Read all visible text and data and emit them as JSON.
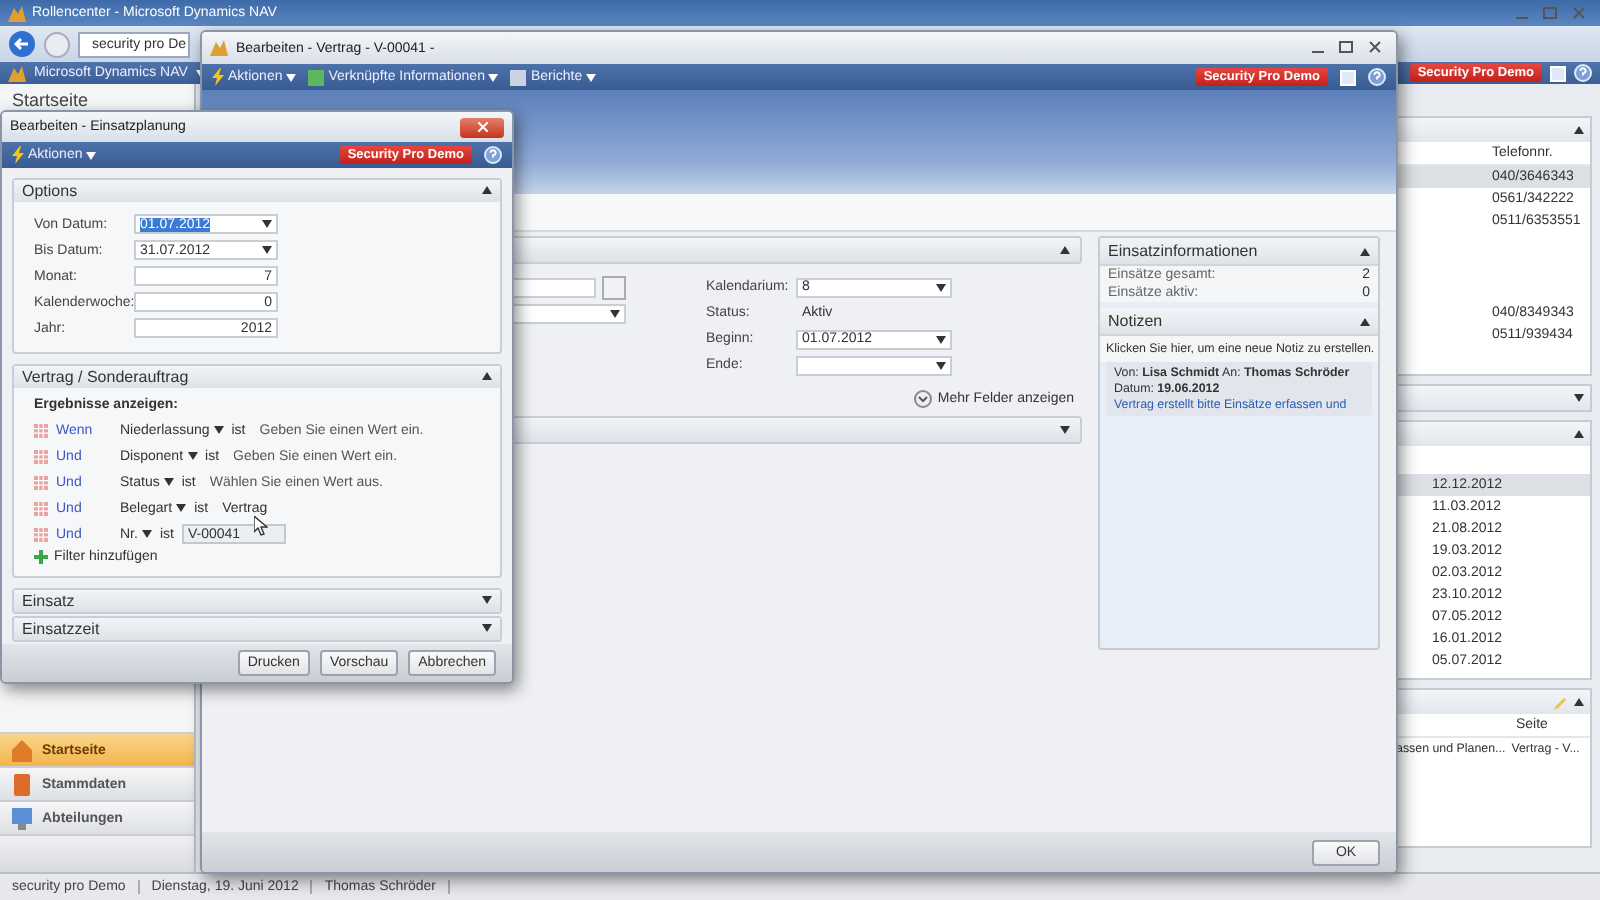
{
  "app": {
    "title": "Rollencenter - Microsoft Dynamics NAV",
    "address": "security pro De",
    "nav_menu": "Microsoft Dynamics NAV",
    "badge": "Security Pro Demo",
    "page_title": "Startseite",
    "navigation": [
      {
        "label": "Startseite",
        "selected": true
      },
      {
        "label": "Stammdaten",
        "selected": false
      },
      {
        "label": "Abteilungen",
        "selected": false
      }
    ],
    "phone_list": {
      "column": "Telefonnr.",
      "rows_top": [
        {
          "text": "040/3646343",
          "selected": true
        },
        {
          "text": "0561/342222",
          "selected": false
        },
        {
          "text": "0511/6353551",
          "selected": false
        }
      ],
      "rows_bottom": [
        {
          "text": "040/8349343",
          "selected": false
        },
        {
          "text": "0511/939434",
          "selected": false
        }
      ]
    },
    "dates": [
      {
        "text": "12.12.2012",
        "selected": true
      },
      {
        "text": "11.03.2012",
        "selected": false
      },
      {
        "text": "21.08.2012",
        "selected": false
      },
      {
        "text": "19.03.2012",
        "selected": false
      },
      {
        "text": "02.03.2012",
        "selected": false
      },
      {
        "text": "23.10.2012",
        "selected": false
      },
      {
        "text": "07.05.2012",
        "selected": false
      },
      {
        "text": "16.01.2012",
        "selected": false
      },
      {
        "text": "05.07.2012",
        "selected": false
      }
    ],
    "pages_list": {
      "column": "Seite",
      "rows": [
        {
          "column_1": "assen und Planen...",
          "seite": "Vertrag - V..."
        }
      ]
    },
    "status_bar": [
      "security pro Demo",
      "Dienstag, 19. Juni 2012",
      "Thomas Schröder"
    ]
  },
  "contract_window": {
    "title": "Bearbeiten - Vertrag - V-00041 -",
    "menu": [
      "Aktionen",
      "Verknüpfte Informationen",
      "Berichte"
    ],
    "badge": "Security Pro Demo",
    "fields": [
      {
        "label": "Kalendarium:",
        "value": "8",
        "dropdown": true
      },
      {
        "label": "Status:",
        "value": "Aktiv",
        "dropdown": false
      },
      {
        "label": "Beginn:",
        "value": "01.07.2012",
        "dropdown": true
      },
      {
        "label": "Ende:",
        "dropdown": true
      }
    ],
    "more_fields": "Mehr Felder anzeigen",
    "factbox": {
      "title": "Einsatzinformationen",
      "rows": [
        {
          "label": "Einsätze gesamt:",
          "value": "2"
        },
        {
          "label": "Einsätze aktiv:",
          "value": "0"
        }
      ]
    },
    "notes": {
      "title": "Notizen",
      "hint": "Klicken Sie hier, um eine neue Notiz zu erstellen.",
      "note_header": "Von: **Lisa Schmidt** An: **Thomas Schröder**",
      "note_date": "Datum: **19.06.2012**",
      "note_text": "Vertrag erstellt bitte Einsätze erfassen und"
    },
    "ok_button": "OK"
  },
  "dialog": {
    "title": "Bearbeiten - Einsatzplanung",
    "menu": "Aktionen",
    "badge": "Security Pro Demo",
    "sections": [
      {
        "title": "Options",
        "expanded": true,
        "kind": "options",
        "fields": [
          {
            "label": "Von Datum:",
            "value": "01.07.2012",
            "dropdown": true,
            "selected": true
          },
          {
            "label": "Bis Datum:",
            "value": "31.07.2012",
            "dropdown": true,
            "selected": false
          },
          {
            "label": "Monat:",
            "value": "7",
            "dropdown": false,
            "selected": false
          },
          {
            "label": "Kalenderwoche:",
            "value": "0",
            "dropdown": false,
            "selected": false
          },
          {
            "label": "Jahr:",
            "value": "2012",
            "dropdown": false,
            "selected": false
          }
        ]
      },
      {
        "title": "Vertrag / Sonderauftrag",
        "expanded": true,
        "kind": "filters",
        "heading": "Ergebnisse anzeigen:",
        "filters": [
          {
            "conjunction": "Wenn",
            "field": "Niederlassung",
            "operator": "ist",
            "placeholder": "Geben Sie einen Wert ein.",
            "kind": "text"
          },
          {
            "conjunction": "Und",
            "field": "Disponent",
            "operator": "ist",
            "placeholder": "Geben Sie einen Wert ein.",
            "kind": "text"
          },
          {
            "conjunction": "Und",
            "field": "Status",
            "operator": "ist",
            "placeholder": "Wählen Sie einen Wert aus.",
            "kind": "text"
          },
          {
            "conjunction": "Und",
            "field": "Belegart",
            "operator": "ist",
            "value": "Vertrag",
            "kind": "text"
          },
          {
            "conjunction": "Und",
            "field": "Nr.",
            "operator": "ist",
            "value": "V-00041",
            "kind": "input"
          }
        ],
        "add_filter": "Filter hinzufügen"
      },
      {
        "title": "Einsatz",
        "expanded": false
      },
      {
        "title": "Einsatzzeit",
        "expanded": false
      }
    ],
    "buttons": [
      "Drucken",
      "Vorschau",
      "Abbrechen"
    ]
  }
}
